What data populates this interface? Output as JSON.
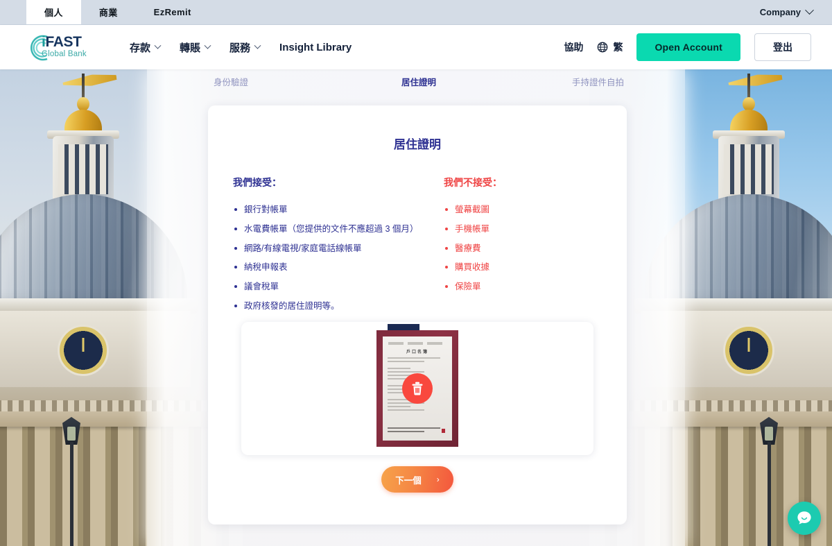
{
  "utility_bar": {
    "tabs": [
      {
        "label": "個人",
        "active": true
      },
      {
        "label": "商業",
        "active": false
      },
      {
        "label": "EzRemit",
        "active": false
      }
    ],
    "company_menu": "Company"
  },
  "nav": {
    "logo": {
      "primary": "iFAST",
      "secondary": "Global Bank"
    },
    "links": [
      {
        "label": "存款",
        "has_dropdown": true
      },
      {
        "label": "轉賬",
        "has_dropdown": true
      },
      {
        "label": "服務",
        "has_dropdown": true
      },
      {
        "label": "Insight Library",
        "has_dropdown": false
      }
    ],
    "help_label": "協助",
    "language_label": "繁",
    "open_account_label": "Open Account",
    "logout_label": "登出"
  },
  "stepper": {
    "steps": [
      {
        "label": "身份驗證",
        "active": false
      },
      {
        "label": "居住證明",
        "active": true
      },
      {
        "label": "手持證件自拍",
        "active": false
      }
    ]
  },
  "card": {
    "title": "居住證明",
    "accepted": {
      "heading": "我們接受：",
      "items": [
        "銀行對帳單",
        "水電費帳單（您提供的文件不應超過 3 個月）",
        "網路/有線電視/家庭電話線帳單",
        "納稅申報表",
        "議會稅單",
        "政府核發的居住證明等。"
      ]
    },
    "rejected": {
      "heading": "我們不接受：",
      "items": [
        "螢幕截圖",
        "手機帳單",
        "醫療費",
        "購買收據",
        "保險單"
      ]
    },
    "upload": {
      "document_title": "戶口名簿",
      "delete_icon": "trash-icon"
    },
    "next_button": {
      "label": "下一個",
      "arrow": "›"
    }
  },
  "chat": {
    "icon": "chat-bubble-icon"
  },
  "colors": {
    "accent_teal": "#0ad9b0",
    "brand_navy": "#2e3192",
    "error_red": "#ef4444",
    "next_gradient_from": "#f7a34a",
    "next_gradient_to": "#f4573d",
    "utility_bar_bg": "#d4dce6",
    "chat_bg": "#1ccbb0"
  }
}
